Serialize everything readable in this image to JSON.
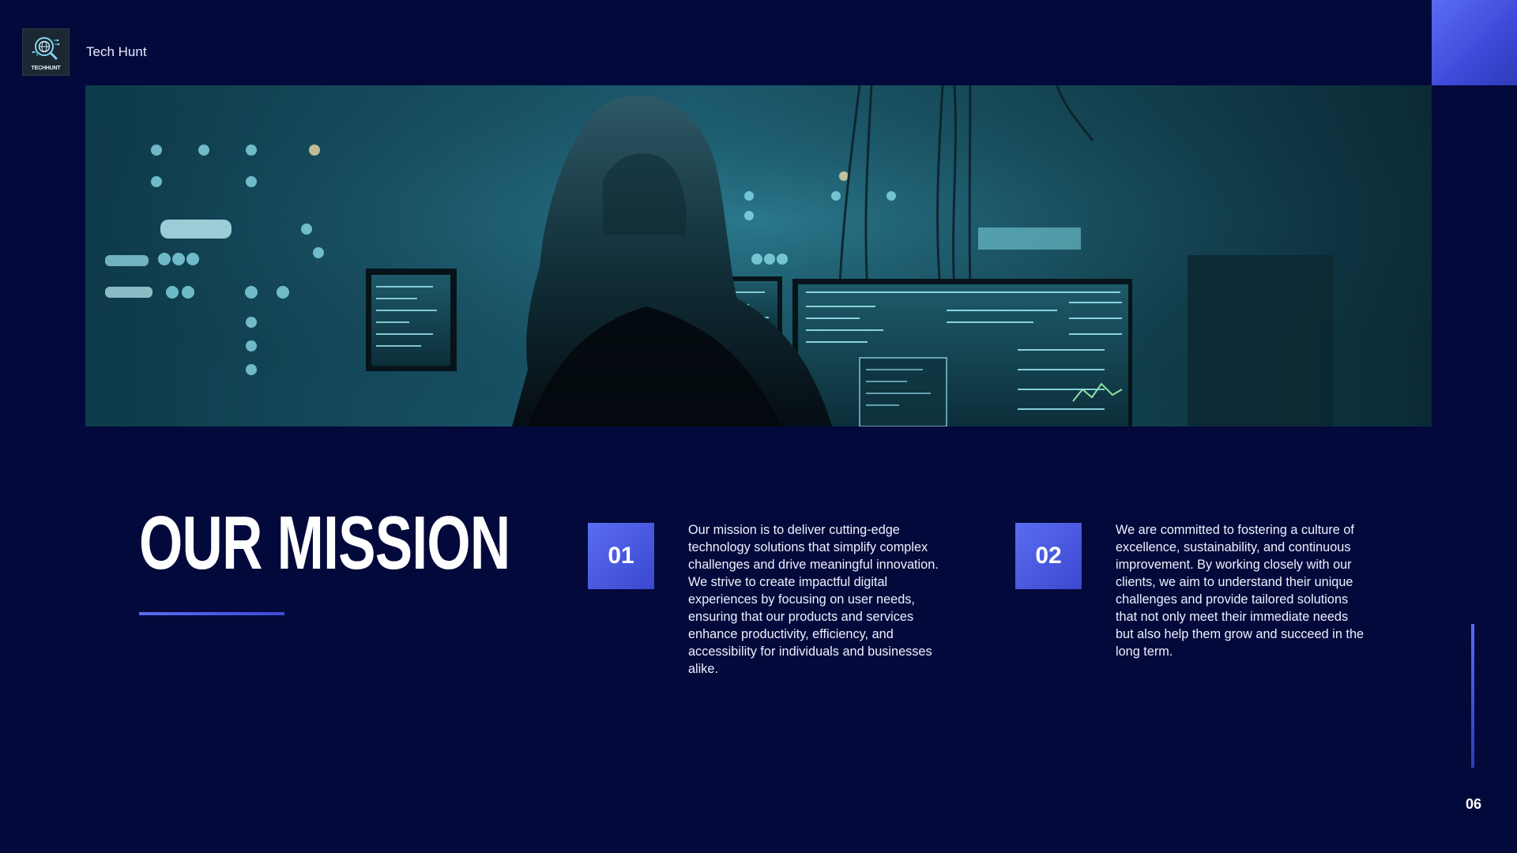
{
  "brand": {
    "name": "Tech Hunt",
    "logo_text": "TECHHUNT",
    "logo_icon": "magnifier-globe-icon"
  },
  "hero": {
    "image": "hooded-figure-at-monitors-illustration"
  },
  "mission": {
    "title": "OUR MISSION",
    "items": [
      {
        "number": "01",
        "text": "Our mission is to deliver cutting-edge technology solutions that simplify complex challenges and drive meaningful innovation. We strive to create impactful digital experiences by focusing on user needs, ensuring that our products and services enhance productivity, efficiency, and accessibility for individuals and businesses alike."
      },
      {
        "number": "02",
        "text": "We are committed to fostering a culture of excellence, sustainability, and continuous improvement. By working closely with our clients, we aim to understand their unique challenges and provide tailored solutions that not only meet their immediate needs but also help them grow and succeed in the long term."
      }
    ]
  },
  "page_number": "06",
  "colors": {
    "background": "#03093a",
    "accent": "#4f5fe8",
    "text": "#ffffff"
  }
}
